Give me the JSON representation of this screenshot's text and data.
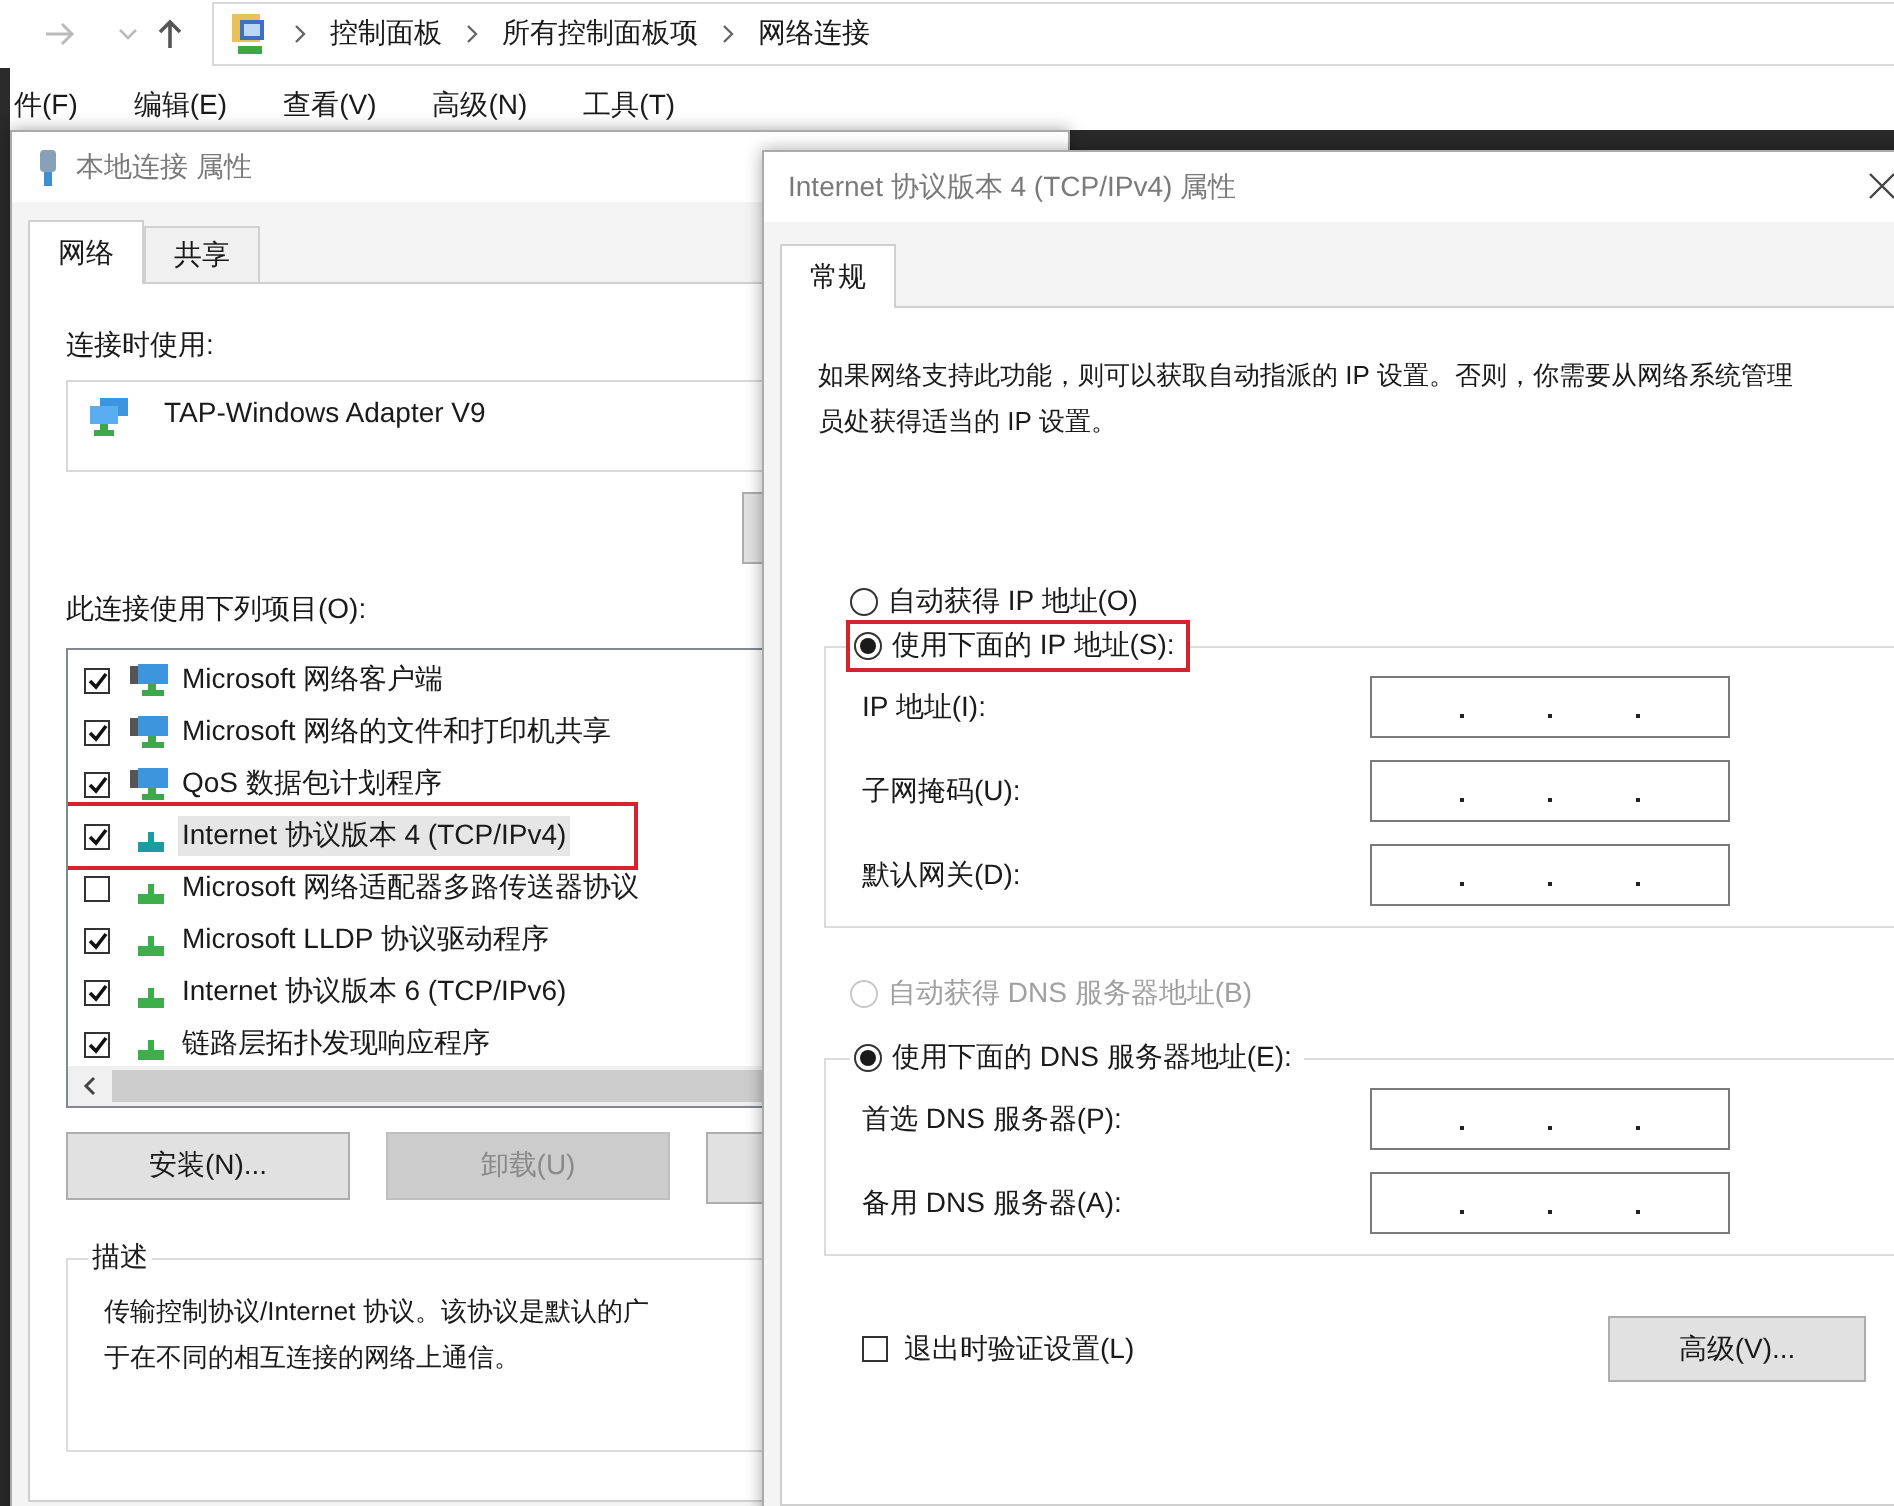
{
  "explorer": {
    "breadcrumb": [
      "控制面板",
      "所有控制面板项",
      "网络连接"
    ],
    "menu": [
      "件(F)",
      "编辑(E)",
      "查看(V)",
      "高级(N)",
      "工具(T)"
    ]
  },
  "connection_dialog": {
    "title": "本地连接 属性",
    "tabs": [
      {
        "label": "网络",
        "selected": true
      },
      {
        "label": "共享",
        "selected": false
      }
    ],
    "connect_using_label": "连接时使用:",
    "adapter": "TAP-Windows Adapter V9",
    "items_label": "此连接使用下列项目(O):",
    "items": [
      {
        "label": "Microsoft 网络客户端",
        "checked": true,
        "kind": "service",
        "selected": false,
        "annotated": false
      },
      {
        "label": "Microsoft 网络的文件和打印机共享",
        "checked": true,
        "kind": "service",
        "selected": false,
        "annotated": false
      },
      {
        "label": "QoS 数据包计划程序",
        "checked": true,
        "kind": "service",
        "selected": false,
        "annotated": false
      },
      {
        "label": "Internet 协议版本 4 (TCP/IPv4)",
        "checked": true,
        "kind": "protocol",
        "selected": true,
        "annotated": true
      },
      {
        "label": "Microsoft 网络适配器多路传送器协议",
        "checked": false,
        "kind": "protocol",
        "selected": false,
        "annotated": false
      },
      {
        "label": "Microsoft LLDP 协议驱动程序",
        "checked": true,
        "kind": "protocol",
        "selected": false,
        "annotated": false
      },
      {
        "label": "Internet 协议版本 6 (TCP/IPv6)",
        "checked": true,
        "kind": "protocol",
        "selected": false,
        "annotated": false
      },
      {
        "label": "链路层拓扑发现响应程序",
        "checked": true,
        "kind": "protocol",
        "selected": false,
        "annotated": false
      }
    ],
    "buttons": [
      {
        "label": "安装(N)...",
        "disabled": false
      },
      {
        "label": "卸载(U)",
        "disabled": true
      }
    ],
    "description": {
      "legend": "描述",
      "lines": [
        "传输控制协议/Internet 协议。该协议是默认的广",
        "于在不同的相互连接的网络上通信。"
      ]
    }
  },
  "ipv4_dialog": {
    "title": "Internet 协议版本 4 (TCP/IPv4) 属性",
    "tabs": [
      {
        "label": "常规",
        "selected": true
      }
    ],
    "intro": "如果网络支持此功能，则可以获取自动指派的 IP 设置。否则，你需要从网络系统管理员处获得适当的 IP 设置。",
    "ip_auto": {
      "label": "自动获得 IP 地址(O)",
      "selected": false,
      "disabled": false,
      "annotated": false
    },
    "ip_manual": {
      "label": "使用下面的 IP 地址(S):",
      "selected": true,
      "disabled": false,
      "annotated": true
    },
    "ip_fields": [
      {
        "label": "IP 地址(I):"
      },
      {
        "label": "子网掩码(U):"
      },
      {
        "label": "默认网关(D):"
      }
    ],
    "dns_auto": {
      "label": "自动获得 DNS 服务器地址(B)",
      "selected": false,
      "disabled": true,
      "annotated": false
    },
    "dns_manual": {
      "label": "使用下面的 DNS 服务器地址(E):",
      "selected": true,
      "disabled": false,
      "annotated": false
    },
    "dns_fields": [
      {
        "label": "首选 DNS 服务器(P):"
      },
      {
        "label": "备用 DNS 服务器(A):"
      }
    ],
    "validate": {
      "label": "退出时验证设置(L)",
      "checked": false
    },
    "advanced_button": "高级(V)..."
  }
}
